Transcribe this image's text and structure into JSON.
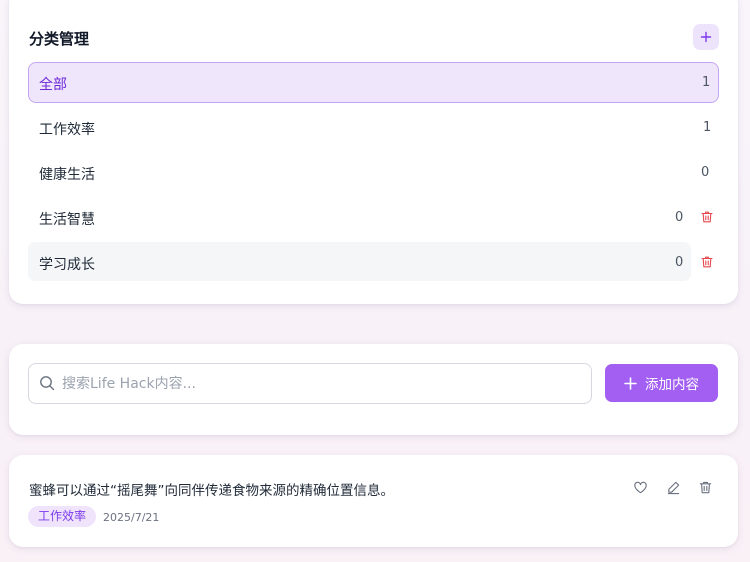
{
  "categories": {
    "title": "分类管理",
    "add_icon": "plus-icon",
    "items": [
      {
        "name": "全部",
        "count": "1"
      },
      {
        "name": "工作效率",
        "count": "1"
      },
      {
        "name": "健康生活",
        "count": "0"
      },
      {
        "name": "生活智慧",
        "count": "0"
      },
      {
        "name": "学习成长",
        "count": "0"
      }
    ],
    "delete_icon": "trash-icon"
  },
  "search": {
    "placeholder": "搜索Life Hack内容...",
    "value": "",
    "icon": "search-icon"
  },
  "toolbar": {
    "add_content_label": "添加内容",
    "add_icon": "plus-icon"
  },
  "items": [
    {
      "text": "蜜蜂可以通过“摇尾舞”向同伴传递食物来源的精确位置信息。",
      "tag": "工作效率",
      "date": "2025/7/21",
      "actions": [
        "heart-icon",
        "edit-icon",
        "trash-icon"
      ]
    }
  ],
  "colors": {
    "accent": "#a35ff2",
    "accent_light": "#efe6fb",
    "danger": "#e5484d"
  }
}
